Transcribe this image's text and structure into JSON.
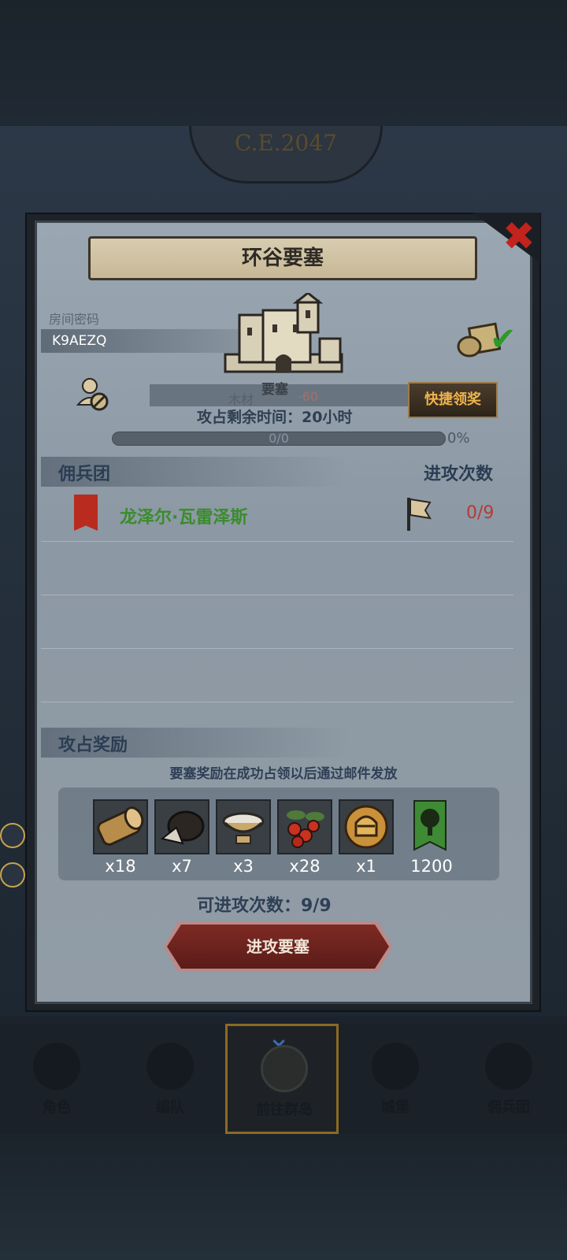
{
  "background": {
    "era_label": "C.E.2047"
  },
  "modal": {
    "title": "环谷要塞",
    "room": {
      "label": "房间密码",
      "code": "K9AEZQ"
    },
    "fortress": {
      "label": "要塞",
      "ghost_resource": "木材",
      "ghost_value": "-60"
    },
    "quick_claim_label": "快捷领奖",
    "time_left": "攻占剩余时间：20小时",
    "progress": {
      "text": "0/0",
      "percent_text": "0%",
      "value": 0
    },
    "mercenary_section": {
      "title": "佣兵团",
      "attacks_header": "进攻次数",
      "rows": [
        {
          "name": "龙泽尔·瓦雷泽斯",
          "attacks": "0/9"
        }
      ]
    },
    "reward_section": {
      "title": "攻占奖励",
      "note": "要塞奖励在成功占领以后通过邮件发放",
      "items": [
        {
          "icon": "wood-log-icon",
          "count": "x18"
        },
        {
          "icon": "truffle-icon",
          "count": "x7"
        },
        {
          "icon": "salt-bowl-icon",
          "count": "x3"
        },
        {
          "icon": "berries-icon",
          "count": "x28"
        },
        {
          "icon": "knight-helmet-coin-icon",
          "count": "x1"
        },
        {
          "icon": "tree-banner-icon",
          "count": "1200"
        }
      ]
    },
    "remaining_attacks": "可进攻次数：9/9",
    "attack_button_label": "进攻要塞"
  },
  "bottom_nav": [
    {
      "label": "角色",
      "icon": "knight-icon"
    },
    {
      "label": "编队",
      "icon": "formation-icon"
    },
    {
      "label": "前往群岛",
      "icon": "compass-icon",
      "active": true
    },
    {
      "label": "城堡",
      "icon": "castle-icon"
    },
    {
      "label": "佣兵团",
      "icon": "mercenary-icon"
    }
  ],
  "colors": {
    "guild_name": "#3a8c2c",
    "attack_count": "#b53a3a",
    "quick_claim": "#f0b44a",
    "close_x": "#c2231d"
  }
}
